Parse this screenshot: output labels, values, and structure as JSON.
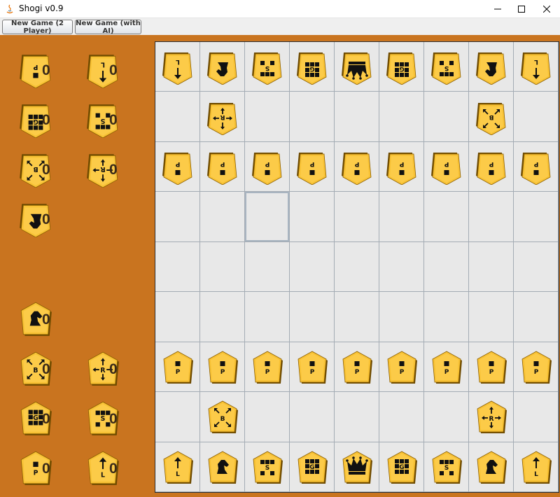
{
  "window": {
    "title": "Shogi v0.9"
  },
  "toolbar": {
    "btn_2p": "New Game (2 Player)",
    "btn_ai": "New Game (with AI)"
  },
  "tray": {
    "top": [
      {
        "piece": "P",
        "count": "0"
      },
      {
        "piece": "L",
        "count": "0"
      },
      {
        "piece": "G",
        "count": "0"
      },
      {
        "piece": "S",
        "count": "0"
      },
      {
        "piece": "B",
        "count": "0"
      },
      {
        "piece": "R",
        "count": "0"
      },
      {
        "piece": "N",
        "count": "0"
      }
    ],
    "bottom": [
      {
        "piece": "N",
        "count": "0"
      },
      {
        "piece": "B",
        "count": "0"
      },
      {
        "piece": "R",
        "count": "0"
      },
      {
        "piece": "G",
        "count": "0"
      },
      {
        "piece": "S",
        "count": "0"
      },
      {
        "piece": "P",
        "count": "0"
      },
      {
        "piece": "L",
        "count": "0"
      }
    ]
  },
  "board": {
    "rows": [
      [
        "gL",
        "gN",
        "gS",
        "gG",
        "gK",
        "gG",
        "gS",
        "gN",
        "gL"
      ],
      [
        "",
        "gR",
        "",
        "",
        "",
        "",
        "",
        "gB",
        ""
      ],
      [
        "gP",
        "gP",
        "gP",
        "gP",
        "gP",
        "gP",
        "gP",
        "gP",
        "gP"
      ],
      [
        "",
        "",
        "",
        "",
        "",
        "",
        "",
        "",
        ""
      ],
      [
        "",
        "",
        "",
        "",
        "",
        "",
        "",
        "",
        ""
      ],
      [
        "",
        "",
        "",
        "",
        "",
        "",
        "",
        "",
        ""
      ],
      [
        "sP",
        "sP",
        "sP",
        "sP",
        "sP",
        "sP",
        "sP",
        "sP",
        "sP"
      ],
      [
        "",
        "sB",
        "",
        "",
        "",
        "",
        "",
        "sR",
        ""
      ],
      [
        "sL",
        "sN",
        "sS",
        "sG",
        "sK",
        "sG",
        "sS",
        "sN",
        "sL"
      ]
    ],
    "selected": "3,2"
  },
  "colors": {
    "tray": "#c9741f",
    "piece": "#f8c235",
    "piece_edge": "#8a5e00",
    "board": "#e8e8e8",
    "grid": "#a4acb4"
  }
}
